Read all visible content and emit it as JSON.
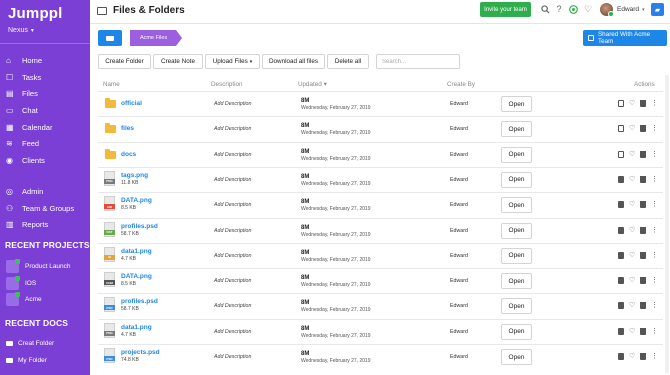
{
  "sidebar": {
    "logo": "Jumppl",
    "org": "Nexus",
    "nav": [
      {
        "label": "Home",
        "icon": "home-icon"
      },
      {
        "label": "Tasks",
        "icon": "tasks-icon"
      },
      {
        "label": "Files",
        "icon": "files-icon"
      },
      {
        "label": "Chat",
        "icon": "chat-icon"
      },
      {
        "label": "Calendar",
        "icon": "calendar-icon"
      },
      {
        "label": "Feed",
        "icon": "feed-icon"
      },
      {
        "label": "Clients",
        "icon": "clients-icon"
      }
    ],
    "nav2": [
      {
        "label": "Admin",
        "icon": "admin-icon"
      },
      {
        "label": "Team & Groups",
        "icon": "team-icon"
      },
      {
        "label": "Reports",
        "icon": "reports-icon"
      }
    ],
    "recent_projects_title": "RECENT PROJECTS",
    "projects": [
      "Product Launch",
      "IOS",
      "Acme"
    ],
    "recent_docs_title": "RECENT DOCS",
    "docs": [
      "Creat Folder",
      "My Folder"
    ]
  },
  "header": {
    "title": "Files & Folders",
    "invite": "Invite your team",
    "user": "Edward"
  },
  "breadcrumb": {
    "folder": "Acme Files"
  },
  "shared_button": "Shared With Acme Team",
  "toolbar": {
    "create_folder": "Create Folder",
    "create_note": "Create Note",
    "upload_files": "Upload Files",
    "download_all": "Download all files",
    "delete_all": "Delete all",
    "search_placeholder": "Search..."
  },
  "columns": {
    "name": "Name",
    "description": "Description",
    "updated": "Updated",
    "created_by": "Create By",
    "actions": "Actions"
  },
  "open_label": "Open",
  "rows": [
    {
      "name": "official",
      "type": "folder",
      "size": "",
      "desc": "Add Description",
      "time": "8M",
      "date": "Wednesday, February 27, 2019",
      "by": "Edward"
    },
    {
      "name": "files",
      "type": "folder",
      "size": "",
      "desc": "Add Description",
      "time": "8M",
      "date": "Wednesday, February 27, 2019",
      "by": "Edward"
    },
    {
      "name": "docs",
      "type": "folder",
      "size": "",
      "desc": "Add Description",
      "time": "8M",
      "date": "Wednesday, February 27, 2019",
      "by": "Edward"
    },
    {
      "name": "tags.png",
      "type": "PNG",
      "size": "11.8 KB",
      "desc": "Add Description",
      "time": "8M",
      "date": "Wednesday, February 27, 2019",
      "by": "Edward"
    },
    {
      "name": "DATA.png",
      "type": "AIR",
      "size": "8.5 KB",
      "desc": "Add Description",
      "time": "8M",
      "date": "Wednesday, February 27, 2019",
      "by": "Edward"
    },
    {
      "name": "profiles.psd",
      "type": "DAT",
      "size": "58.7 KB",
      "desc": "Add Description",
      "time": "8M",
      "date": "Wednesday, February 27, 2019",
      "by": "Edward"
    },
    {
      "name": "data1.png",
      "type": "AI",
      "size": "4.7 KB",
      "desc": "Add Description",
      "time": "8M",
      "date": "Wednesday, February 27, 2019",
      "by": "Edward"
    },
    {
      "name": "DATA.png",
      "type": "CHM",
      "size": "8.5 KB",
      "desc": "Add Description",
      "time": "8M",
      "date": "Wednesday, February 27, 2019",
      "by": "Edward"
    },
    {
      "name": "profiles.psd",
      "type": "PSD",
      "size": "58.7 KB",
      "desc": "Add Description",
      "time": "8M",
      "date": "Wednesday, February 27, 2019",
      "by": "Edward"
    },
    {
      "name": "data1.png",
      "type": "PNG",
      "size": "4.7 KB",
      "desc": "Add Description",
      "time": "8M",
      "date": "Wednesday, February 27, 2019",
      "by": "Edward"
    },
    {
      "name": "projects.psd",
      "type": "PSD",
      "size": "74.8 KB",
      "desc": "Add Description",
      "time": "8M",
      "date": "Wednesday, February 27, 2019",
      "by": "Edward"
    }
  ],
  "colors": {
    "sidebar": "#7b3fd6",
    "accent_blue": "#1e86e6",
    "invite_green": "#2fae4e",
    "folder_yellow": "#f3b93a"
  }
}
